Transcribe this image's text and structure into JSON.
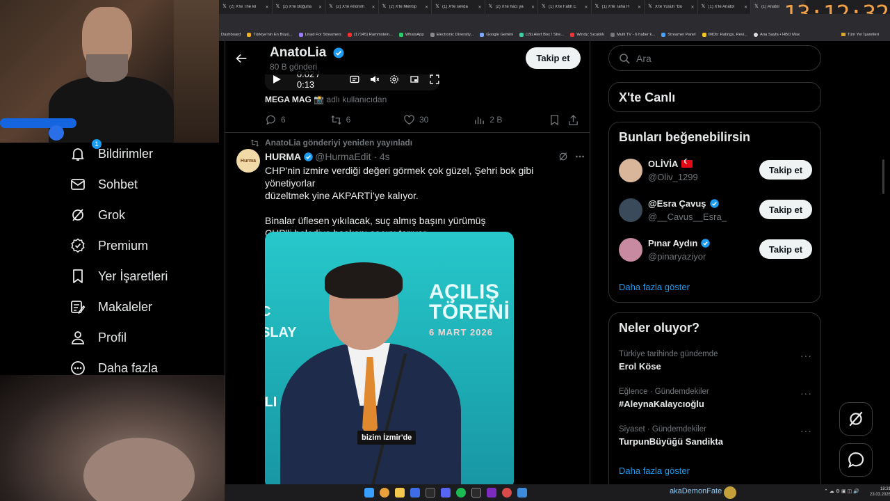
{
  "overlay": {
    "clock": "13:12:32",
    "streamer_name": "akaDemonFate"
  },
  "browser": {
    "tabs": [
      {
        "label": "(2) X'te The kil",
        "icon": "x-icon"
      },
      {
        "label": "(2) X'te Boğuna",
        "icon": "x-icon"
      },
      {
        "label": "(2) X'te Anonim",
        "icon": "x-icon"
      },
      {
        "label": "(2) X'te Metrop",
        "icon": "x-icon"
      },
      {
        "label": "(1) X'te sevda",
        "icon": "x-icon"
      },
      {
        "label": "(2) X'te hacı ya",
        "icon": "x-icon"
      },
      {
        "label": "(1) X'te Fatih E",
        "icon": "x-icon"
      },
      {
        "label": "(1) X'te Taha H",
        "icon": "x-icon"
      },
      {
        "label": "X'te Yusufi \"Bu",
        "icon": "x-icon"
      },
      {
        "label": "(1) X'te Anatol",
        "icon": "x-icon"
      },
      {
        "label": "(1) Anatol",
        "icon": "x-icon"
      }
    ],
    "bookmarks": [
      {
        "label": "Dashboard",
        "color": "#444"
      },
      {
        "label": "Türkiye'nin En Büyü...",
        "color": "#f2b01e"
      },
      {
        "label": "Livad For Streamers",
        "color": "#9b7bff"
      },
      {
        "label": "(17145) Rammstein...",
        "color": "#ff2b2b"
      },
      {
        "label": "WhatsApp",
        "color": "#25d366"
      },
      {
        "label": "Electronic Diversity...",
        "color": "#888"
      },
      {
        "label": "Google Gemini",
        "color": "#7aa8ff"
      },
      {
        "label": "(19) Alert Box / Stre...",
        "color": "#3ad29f"
      },
      {
        "label": "Windy: Sıcaklık",
        "color": "#e33"
      },
      {
        "label": "Multi TV - 6 haber k...",
        "color": "#777"
      },
      {
        "label": "Streamer Panel",
        "color": "#4aa3ff"
      },
      {
        "label": "IMDb: Ratings, Revi...",
        "color": "#f5c518"
      },
      {
        "label": "Ana Sayfa • HBO Max",
        "color": "#ddd"
      }
    ],
    "bookmarks_all": "Tüm Yer İşaretleri"
  },
  "sidebar": {
    "items": [
      {
        "label": "Bildirimler",
        "icon": "bell-icon",
        "badge": "1"
      },
      {
        "label": "Sohbet",
        "icon": "mail-icon"
      },
      {
        "label": "Grok",
        "icon": "grok-icon"
      },
      {
        "label": "Premium",
        "icon": "premium-icon"
      },
      {
        "label": "Yer İşaretleri",
        "icon": "bookmark-icon"
      },
      {
        "label": "Makaleler",
        "icon": "articles-icon"
      },
      {
        "label": "Profil",
        "icon": "person-icon"
      },
      {
        "label": "Daha fazla",
        "icon": "more-circle-icon"
      }
    ]
  },
  "header": {
    "name": "AnatoLia",
    "posts_count": "80 B gönderi",
    "follow_label": "Takip et"
  },
  "prev_post": {
    "video_time": "0:02 / 0:13",
    "source_author": "MEGA MAG 📸",
    "source_suffix": "adlı kullanıcıdan",
    "replies": "6",
    "reposts": "6",
    "likes": "30",
    "views": "2 B"
  },
  "post": {
    "repost_note": "AnatoLia gönderiyi yeniden yayınladı",
    "avatar_text": "Hurma",
    "name": "HURMA",
    "handle": "@HurmaEdit · 4s",
    "text": "CHP'nin izmire verdiği değeri görmek çok güzel, Şehri bok gibi yönetiyorlar\ndüzeltmek yine AKPARTİ'ye kalıyor.\n\nBinalar üflesen yıkılacak, suç almış başını yürümüş\nCHP'li belediye başkanı saçını tarıyor",
    "media": {
      "sign_line1": "AÇILIŞ",
      "sign_line2": "TÖRENİ",
      "sign_date": "6 MART 2026",
      "left_line1": "C",
      "left_line2": "SLAY",
      "left_line3": "ILI",
      "caption": "bizim İzmir'de"
    }
  },
  "right": {
    "search_placeholder": "Ara",
    "live_title": "X'te Canlı",
    "suggest_title": "Bunları beğenebilirsin",
    "suggestions": [
      {
        "name": "OLİVİA",
        "handle": "@Oliv_1299",
        "follow": "Takip et",
        "avatar_color": "#d9b59a"
      },
      {
        "name": "@Esra Çavuş",
        "handle": "@__Cavus__Esra_",
        "follow": "Takip et",
        "avatar_color": "#3a4a5a"
      },
      {
        "name": "Pınar Aydın",
        "handle": "@pinaryaziyor",
        "follow": "Takip et",
        "avatar_color": "#c78aa0"
      }
    ],
    "show_more": "Daha fazla göster",
    "trends_title": "Neler oluyor?",
    "trends": [
      {
        "context": "Türkiye tarihinde gündemde",
        "title": "Erol Köse"
      },
      {
        "context": "Eğlence · Gündemdekiler",
        "title": "#AleynaKalaycıoğlu"
      },
      {
        "context": "Siyaset · Gündemdekiler",
        "title": "TurpunBüyüğü Sandikta"
      }
    ],
    "trends_more": "Daha fazla göster"
  },
  "taskbar": {
    "time": "18:31",
    "date": "23.03.2026"
  },
  "colors": {
    "accent": "#1d9bf0",
    "background": "#000000",
    "clock": "#f0a048"
  }
}
